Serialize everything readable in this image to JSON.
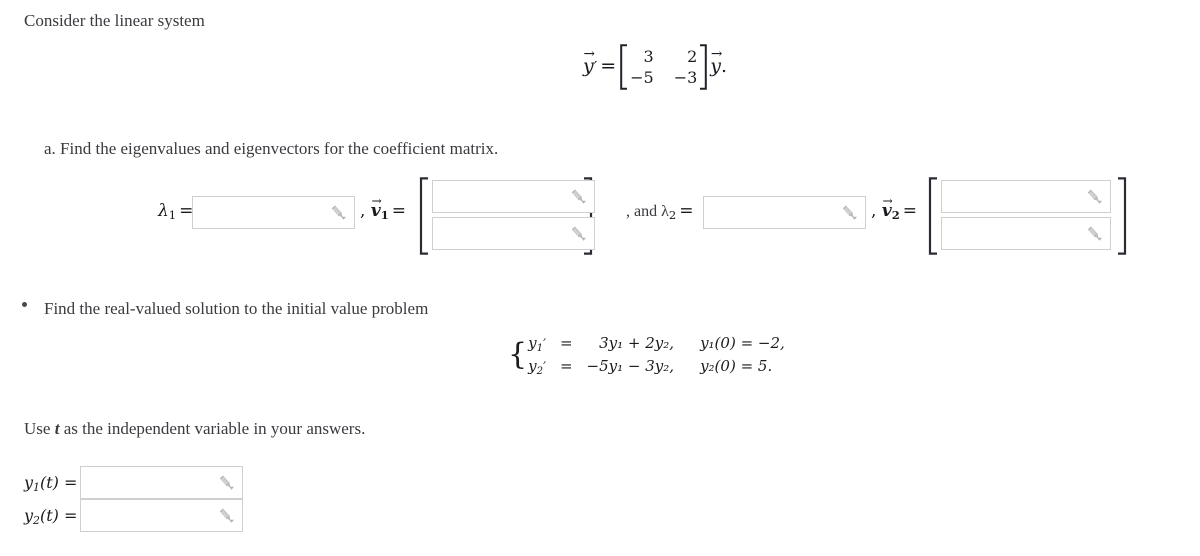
{
  "intro": {
    "text": "Consider the linear system"
  },
  "system_equation": {
    "lhs": "y⃗′",
    "equals": "=",
    "matrix": {
      "rows": [
        [
          "3",
          "2"
        ],
        [
          "−5",
          "−3"
        ]
      ]
    },
    "rhs": "y⃗",
    "period": "."
  },
  "part_a": {
    "label": "a. Find the eigenvalues and eigenvectors for the coefficient matrix.",
    "lambda1_label": "λ",
    "lambda1_sub": "1",
    "equals": "=",
    "comma": ",",
    "v1_label": "v",
    "v1_sub": "1",
    "and_lambda2_text": ", and λ",
    "lambda2_sub": "2",
    "comma2": ",",
    "v2_label": "v",
    "v2_sub": "2",
    "fields": {
      "lambda1": {
        "value": "",
        "placeholder": ""
      },
      "v1_row1": {
        "value": "",
        "placeholder": ""
      },
      "v1_row2": {
        "value": "",
        "placeholder": ""
      },
      "lambda2": {
        "value": "",
        "placeholder": ""
      },
      "v2_row1": {
        "value": "",
        "placeholder": ""
      },
      "v2_row2": {
        "value": "",
        "placeholder": ""
      }
    }
  },
  "part_b": {
    "label": "Find the real-valued solution to the initial value problem",
    "ivp": {
      "row1": {
        "lhs": "y",
        "lhs_sub": "1",
        "prime": "′",
        "eq": "=",
        "rhs": "3y₁ + 2y₂,",
        "ic": "y₁(0) = −2,"
      },
      "row2": {
        "lhs": "y",
        "lhs_sub": "2",
        "prime": "′",
        "eq": "=",
        "rhs": "−5y₁ − 3y₂,",
        "ic": "y₂(0) = 5."
      }
    }
  },
  "instruction": {
    "prefix": "Use ",
    "variable": "t",
    "suffix": " as the independent variable in your answers."
  },
  "answers": {
    "y1_label": "y",
    "y1_sub": "1",
    "y1_arg": "(t) =",
    "y2_label": "y",
    "y2_sub": "2",
    "y2_arg": "(t) =",
    "fields": {
      "y1": {
        "value": "",
        "placeholder": ""
      },
      "y2": {
        "value": "",
        "placeholder": ""
      }
    }
  },
  "icons": {
    "pencil": "pencil-icon",
    "caret": "chevron-down-icon"
  },
  "colors": {
    "page_background": "#ffffff",
    "text": "#3a3a3f",
    "math_text": "#1b1b1f",
    "input_border": "#cfcfcf",
    "icon_gray": "#b3b3b3",
    "bracket": "#2b2b33"
  }
}
